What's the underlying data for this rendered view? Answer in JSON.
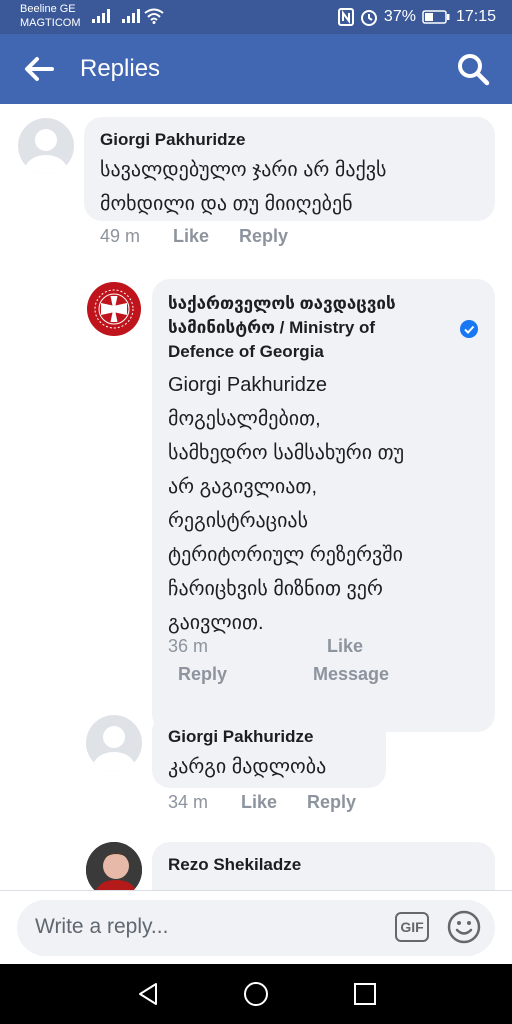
{
  "status": {
    "carrier_line1": "Beeline GE",
    "carrier_line2": "MAGTICOM",
    "battery": "37%",
    "time": "17:15",
    "icons": [
      "signal-icon",
      "wifi-icon",
      "nfc-icon",
      "alarm-icon",
      "battery-icon"
    ]
  },
  "appbar": {
    "title": "Replies",
    "icons": [
      "back-arrow-icon",
      "search-icon"
    ]
  },
  "comments": [
    {
      "name": "Giorgi Pakhuridze",
      "lines": [
        "სავალდებულო ჯარი არ მაქვს",
        "მოხდილი და თუ მიიღებენ"
      ],
      "time": "49 m",
      "like": "Like",
      "reply": "Reply"
    },
    {
      "name_lines": [
        "საქართველოს თავდაცვის",
        "სამინისტრო / Ministry of",
        "Defence of Georgia"
      ],
      "verified": true,
      "lines": [
        "Giorgi Pakhuridze",
        "მოგესალმებით,",
        "სამხედრო სამსახური თუ",
        "არ გაგივლიათ,",
        "რეგისტრაციას",
        "ტერიტორიულ რეზერვში",
        "ჩარიცხვის მიზნით ვერ",
        "გაივლით."
      ],
      "time": "36 m",
      "like": "Like",
      "reply": "Reply",
      "message": "Message"
    },
    {
      "name": "Giorgi Pakhuridze",
      "lines": [
        "კარგი მადლობა"
      ],
      "time": "34 m",
      "like": "Like",
      "reply": "Reply"
    },
    {
      "name": "Rezo Shekiladze"
    }
  ],
  "composer": {
    "placeholder": "Write a reply...",
    "gif_label": "GIF",
    "icons": [
      "gif-icon",
      "emoji-icon"
    ]
  },
  "nav": {
    "icons": [
      "nav-back-icon",
      "nav-home-icon",
      "nav-recents-icon"
    ]
  },
  "colors": {
    "header": "#4267b2",
    "status_bar": "#3b5998",
    "bubble": "#f0f2f5",
    "verified": "#1877f2",
    "ministry_red": "#c0141c"
  }
}
